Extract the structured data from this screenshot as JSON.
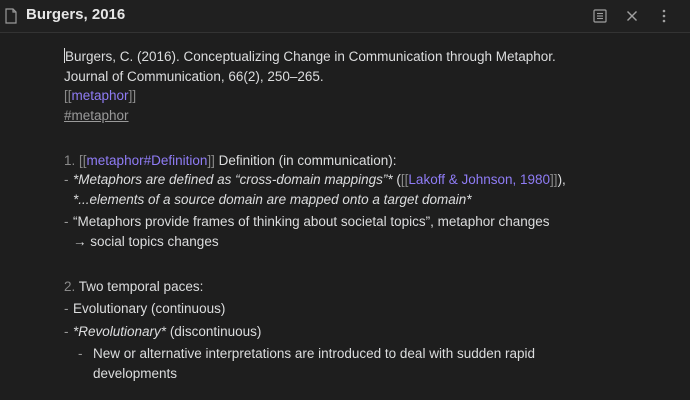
{
  "header": {
    "title": "Burgers, 2016",
    "icons": [
      "file-icon",
      "reading-view-icon",
      "close-icon",
      "more-options-icon"
    ]
  },
  "note": {
    "citation_line1": "Burgers, C. (2016). Conceptualizing Change in Communication through Metaphor.",
    "citation_line2": "Journal of Communication, 66(2), 250–265.",
    "link_metaphor": "[[metaphor]]",
    "link_metaphor_open": "[[",
    "link_metaphor_text": "metaphor",
    "link_metaphor_close": "]]",
    "tag": "#metaphor",
    "item1": {
      "number": "1.",
      "link_open": "[[",
      "link_text": "metaphor#Definition",
      "link_close": "]]",
      "label": " Definition (in communication):",
      "bullet1_part1": "*Metaphors are defined as “cross-domain mappings”*",
      "bullet1_paren_open": " (",
      "bullet1_link_open": "[[",
      "bullet1_link_text": "Lakoff & Johnson, 1980",
      "bullet1_link_close": "]]",
      "bullet1_paren_close": "),",
      "bullet1_line2": "*...elements of a source domain are mapped onto a target domain*",
      "bullet2": "“Metaphors provide frames of thinking about societal topics”, metaphor changes → social topics changes"
    },
    "item2": {
      "number": "2.",
      "label": " Two temporal paces:",
      "bullet1": "Evolutionary (continuous)",
      "bullet2_italic": "*Revolutionary*",
      "bullet2_rest": " (discontinuous)",
      "sub_bullet": "New or alternative interpretations are introduced to deal with sudden rapid developments"
    },
    "bullet_dash": "-"
  },
  "colors": {
    "background": "#1e1e1e",
    "text": "#dcddde",
    "link": "#8f7cf5",
    "muted": "#8a8a8a"
  }
}
